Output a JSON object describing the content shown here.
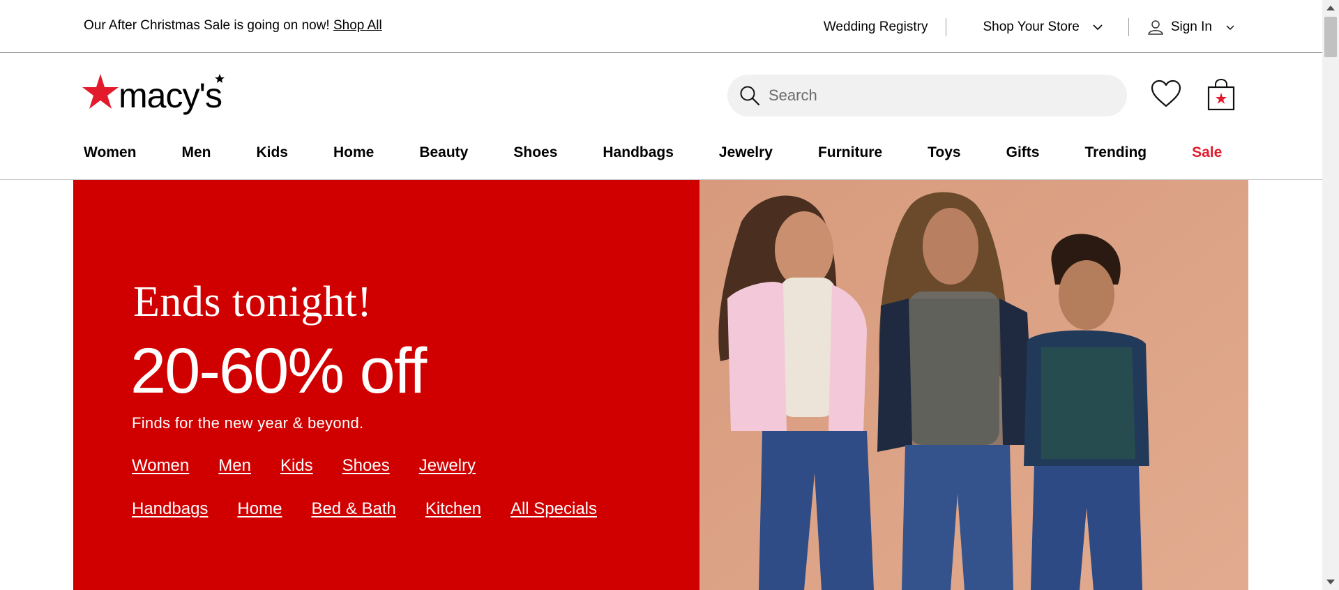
{
  "utility": {
    "promo_text": "Our After Christmas Sale is going on now!",
    "promo_link": "Shop All",
    "wedding_registry": "Wedding Registry",
    "shop_your_store": "Shop Your Store",
    "sign_in": "Sign In"
  },
  "header": {
    "logo_text": "macy's",
    "search_placeholder": "Search"
  },
  "nav": {
    "categories": [
      "Women",
      "Men",
      "Kids",
      "Home",
      "Beauty",
      "Shoes",
      "Handbags",
      "Jewelry",
      "Furniture",
      "Toys",
      "Gifts",
      "Trending"
    ],
    "sale": "Sale"
  },
  "hero": {
    "eyebrow": "Ends tonight!",
    "headline": "20-60% off",
    "subtext": "Finds for the new year & beyond.",
    "links_row1": [
      "Women",
      "Men",
      "Kids",
      "Shoes",
      "Jewelry"
    ],
    "links_row2": [
      "Handbags",
      "Home",
      "Bed & Bath",
      "Kitchen",
      "All Specials"
    ]
  },
  "colors": {
    "brand_red": "#e21a2c",
    "hero_red": "#d10000",
    "photo_backdrop": "#d9a184"
  },
  "icons": [
    "chevron-down-icon",
    "user-icon",
    "search-icon",
    "heart-icon",
    "shopping-bag-icon",
    "macys-star-icon"
  ]
}
